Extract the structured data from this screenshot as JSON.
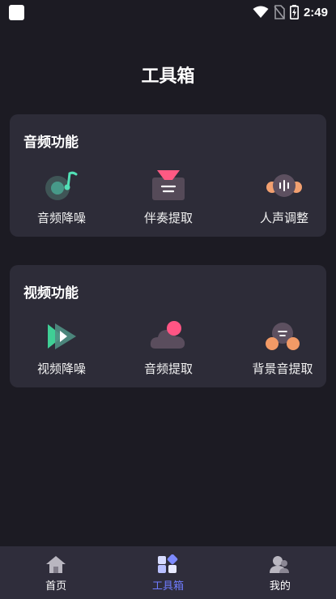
{
  "status_bar": {
    "time": "2:49"
  },
  "page": {
    "title": "工具箱"
  },
  "audio_section": {
    "title": "音频功能",
    "tools": [
      {
        "label": "音频降噪",
        "icon": "audio-denoise-icon"
      },
      {
        "label": "伴奏提取",
        "icon": "accompaniment-extract-icon"
      },
      {
        "label": "人声调整",
        "icon": "vocal-adjust-icon"
      }
    ]
  },
  "video_section": {
    "title": "视频功能",
    "tools": [
      {
        "label": "视频降噪",
        "icon": "video-denoise-icon"
      },
      {
        "label": "音频提取",
        "icon": "audio-extract-icon"
      },
      {
        "label": "背景音提取",
        "icon": "background-audio-extract-icon"
      }
    ]
  },
  "bottom_nav": {
    "items": [
      {
        "label": "首页",
        "icon": "home-icon"
      },
      {
        "label": "工具箱",
        "icon": "toolbox-icon",
        "active": true
      },
      {
        "label": "我的",
        "icon": "profile-icon"
      }
    ]
  },
  "colors": {
    "background": "#1c1b23",
    "card": "#2d2c38",
    "nav_bar": "#2f2d3b",
    "active_nav": "#6f7cff"
  }
}
